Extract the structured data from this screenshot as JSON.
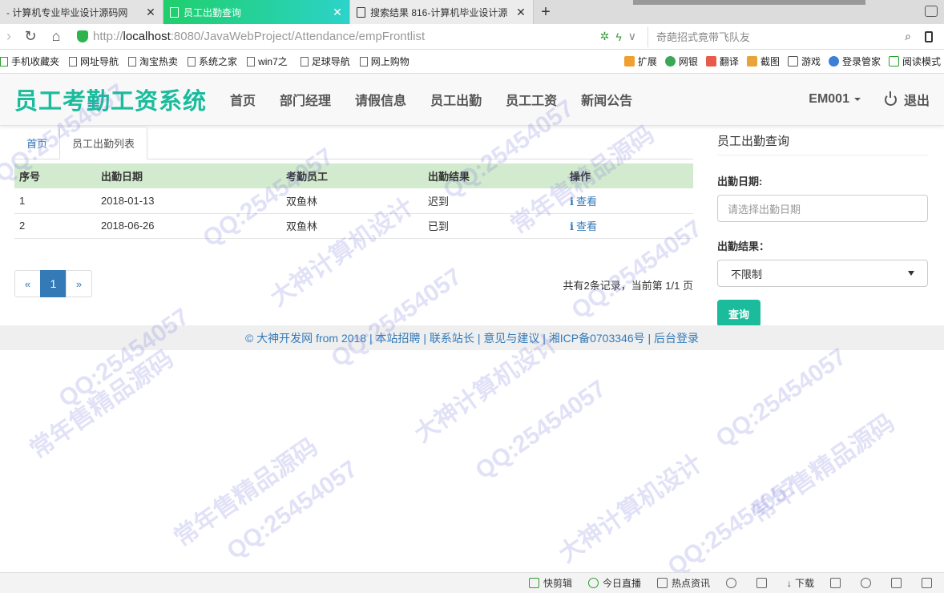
{
  "browser": {
    "tabs": [
      {
        "title": "- 计算机专业毕业设计源码网",
        "active": false
      },
      {
        "title": "员工出勤查询",
        "active": true
      },
      {
        "title": "搜索结果 816-计算机毕业设计源",
        "active": false
      }
    ],
    "url_scheme": "http://",
    "url_host": "localhost",
    "url_path": ":8080/JavaWebProject/Attendance/empFrontlist",
    "search_placeholder": "奇葩招式竟带飞队友",
    "bookmarks": [
      "手机收藏夹",
      "网址导航",
      "淘宝热卖",
      "系统之家",
      "win7之",
      "足球导航",
      "网上购物"
    ],
    "toolbar": [
      "扩展",
      "网银",
      "翻译",
      "截图",
      "游戏",
      "登录管家",
      "阅读模式"
    ],
    "statusbar": [
      "快剪辑",
      "今日直播",
      "热点资讯",
      "下载"
    ]
  },
  "header": {
    "brand": "员工考勤工资系统",
    "nav": [
      "首页",
      "部门经理",
      "请假信息",
      "员工出勤",
      "员工工资",
      "新闻公告"
    ],
    "user": "EM001",
    "logout": "退出"
  },
  "crumbs": {
    "home": "首页",
    "current": "员工出勤列表"
  },
  "table": {
    "headers": [
      "序号",
      "出勤日期",
      "考勤员工",
      "出勤结果",
      "操作"
    ],
    "rows": [
      {
        "no": "1",
        "date": "2018-01-13",
        "employee": "双鱼林",
        "result": "迟到",
        "action": "查看"
      },
      {
        "no": "2",
        "date": "2018-06-26",
        "employee": "双鱼林",
        "result": "已到",
        "action": "查看"
      }
    ]
  },
  "pager": {
    "prev": "«",
    "current": "1",
    "next": "»",
    "info": "共有2条记录，当前第 1/1 页"
  },
  "query": {
    "title": "员工出勤查询",
    "date_label": "出勤日期:",
    "date_placeholder": "请选择出勤日期",
    "result_label": "出勤结果：",
    "result_selected": "不限制",
    "button": "查询"
  },
  "footer": {
    "text": "© 大神开发网 from 2018 | 本站招聘 | 联系站长 | 意见与建议 | 湘ICP备0703346号 | 后台登录"
  },
  "watermark": {
    "qq": "QQ:25454057",
    "slogan1": "常年售精品源码",
    "slogan2": "大神计算机设计"
  }
}
